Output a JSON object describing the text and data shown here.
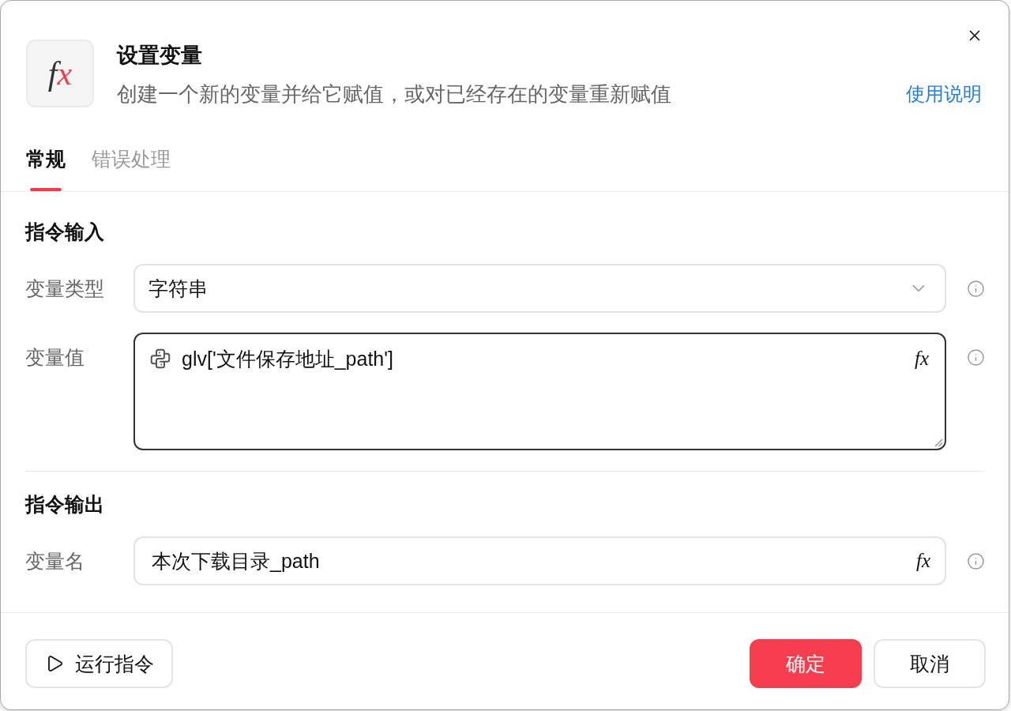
{
  "dialog": {
    "icon_symbol": [
      "f",
      "x"
    ],
    "title": "设置变量",
    "description": "创建一个新的变量并给它赋值，或对已经存在的变量重新赋值",
    "help_link": "使用说明"
  },
  "tabs": [
    {
      "label": "常规",
      "selected": true
    },
    {
      "label": "错误处理",
      "selected": false
    }
  ],
  "sections": [
    {
      "title": "指令输入",
      "fields": [
        {
          "kind": "select",
          "label": "变量类型",
          "value": "字符串",
          "focused": false,
          "python_expression": false
        },
        {
          "kind": "textarea",
          "label": "变量值",
          "value": "glv['文件保存地址_path']",
          "focused": true,
          "python_expression": true,
          "formula_button": "fx"
        }
      ]
    },
    {
      "title": "指令输出",
      "fields": [
        {
          "kind": "input",
          "label": "变量名",
          "value": "本次下载目录_path",
          "focused": false,
          "python_expression": false,
          "formula_button": "fx"
        }
      ]
    }
  ],
  "footer": {
    "run_button": "运行指令",
    "buttons": [
      {
        "label": "确定",
        "primary": true
      },
      {
        "label": "取消",
        "primary": false
      }
    ]
  }
}
